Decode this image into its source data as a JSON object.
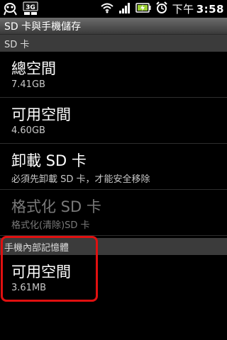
{
  "status_bar": {
    "time_prefix": "下午",
    "time": "3:58",
    "network_badge": "3G",
    "icons": [
      "alien-notification-icon",
      "3g-icon",
      "wifi-icon",
      "signal-icon",
      "battery-charging-icon",
      "alarm-icon"
    ]
  },
  "title_bar": {
    "title": "SD 卡與手機儲存"
  },
  "sections": {
    "sd_card": {
      "header": "SD 卡"
    },
    "internal": {
      "header": "手機內部記憶體"
    }
  },
  "items": {
    "total_space": {
      "title": "總空間",
      "summary": "7.41GB"
    },
    "available_space": {
      "title": "可用空間",
      "summary": "4.60GB"
    },
    "unmount_sd": {
      "title": "卸載 SD 卡",
      "summary": "必須先卸載 SD 卡，才能安全移除"
    },
    "format_sd": {
      "title": "格式化 SD 卡",
      "summary": "格式化(清除)SD 卡"
    },
    "internal_available": {
      "title": "可用空間",
      "summary": "3.61MB"
    }
  },
  "colors": {
    "background": "#000000",
    "section_header": "#3b3b3b",
    "highlight": "#e01010",
    "disabled_text": "#7a7a7a"
  }
}
